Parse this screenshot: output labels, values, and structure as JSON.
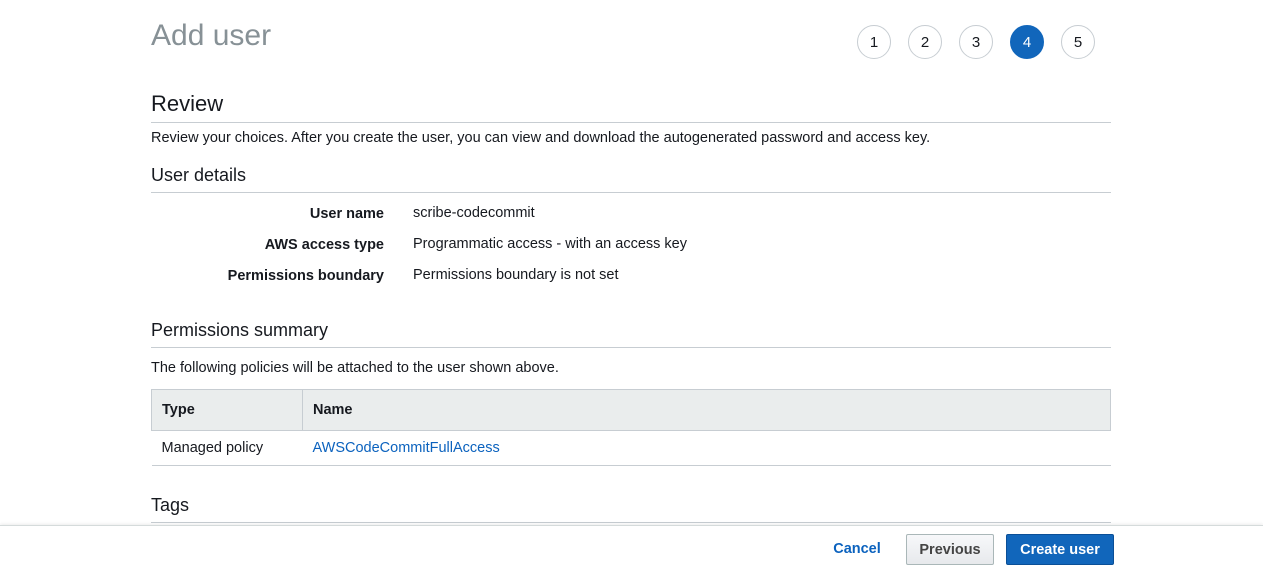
{
  "page": {
    "title": "Add user",
    "steps": [
      "1",
      "2",
      "3",
      "4",
      "5"
    ],
    "active_step": "4"
  },
  "review": {
    "heading": "Review",
    "intro": "Review your choices. After you create the user, you can view and download the autogenerated password and access key."
  },
  "user_details": {
    "heading": "User details",
    "rows": [
      {
        "label": "User name",
        "value": "scribe-codecommit"
      },
      {
        "label": "AWS access type",
        "value": "Programmatic access - with an access key"
      },
      {
        "label": "Permissions boundary",
        "value": "Permissions boundary is not set"
      }
    ]
  },
  "permissions": {
    "heading": "Permissions summary",
    "intro": "The following policies will be attached to the user shown above.",
    "columns": {
      "type": "Type",
      "name": "Name"
    },
    "rows": [
      {
        "type": "Managed policy",
        "name": "AWSCodeCommitFullAccess"
      }
    ]
  },
  "tags": {
    "heading": "Tags"
  },
  "footer": {
    "cancel_label": "Cancel",
    "previous_label": "Previous",
    "create_label": "Create user"
  },
  "colors": {
    "accent": "#1166bb",
    "link": "#0b62be",
    "title_gray": "#879196"
  }
}
